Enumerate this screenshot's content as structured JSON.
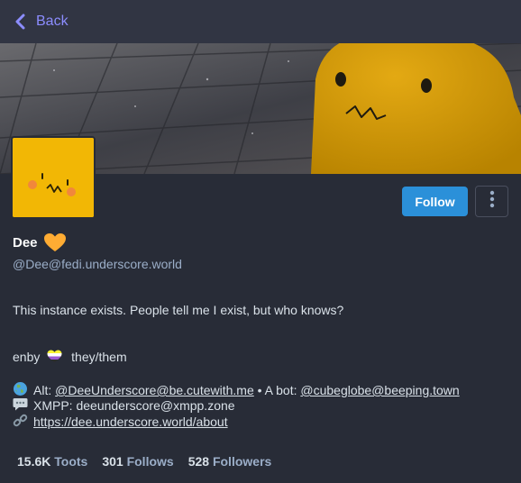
{
  "nav": {
    "back_label": "Back"
  },
  "profile": {
    "display_name": "Dee",
    "handle": "@Dee@fedi.underscore.world",
    "follow_label": "Follow",
    "bio": {
      "line1": "This instance exists. People tell me I exist, but who knows?",
      "pronouns_prefix": "enby",
      "pronouns": "they/them",
      "alt_prefix": "Alt: ",
      "alt_account": "@DeeUnderscore@be.cutewith.me",
      "bot_prefix": " • A bot: ",
      "bot_account": "@cubeglobe@beeping.town",
      "xmpp": "XMPP: deeunderscore@xmpp.zone",
      "link": "https://dee.underscore.world/about"
    },
    "stats": [
      {
        "value": "15.6K",
        "label": "Toots"
      },
      {
        "value": "301",
        "label": "Follows"
      },
      {
        "value": "528",
        "label": "Followers"
      }
    ]
  },
  "colors": {
    "accent": "#8c8dff",
    "follow_button": "#2b90d9",
    "avatar_yellow": "#f2b705",
    "heart": "#ffac33"
  },
  "icons": {
    "back": "chevron-left-icon",
    "more": "vertical-ellipsis-icon",
    "heart": "orange-heart-icon",
    "globe": "globe-icon",
    "speech": "speech-bubble-icon",
    "link": "link-icon",
    "flag": "nonbinary-heart-icon"
  }
}
